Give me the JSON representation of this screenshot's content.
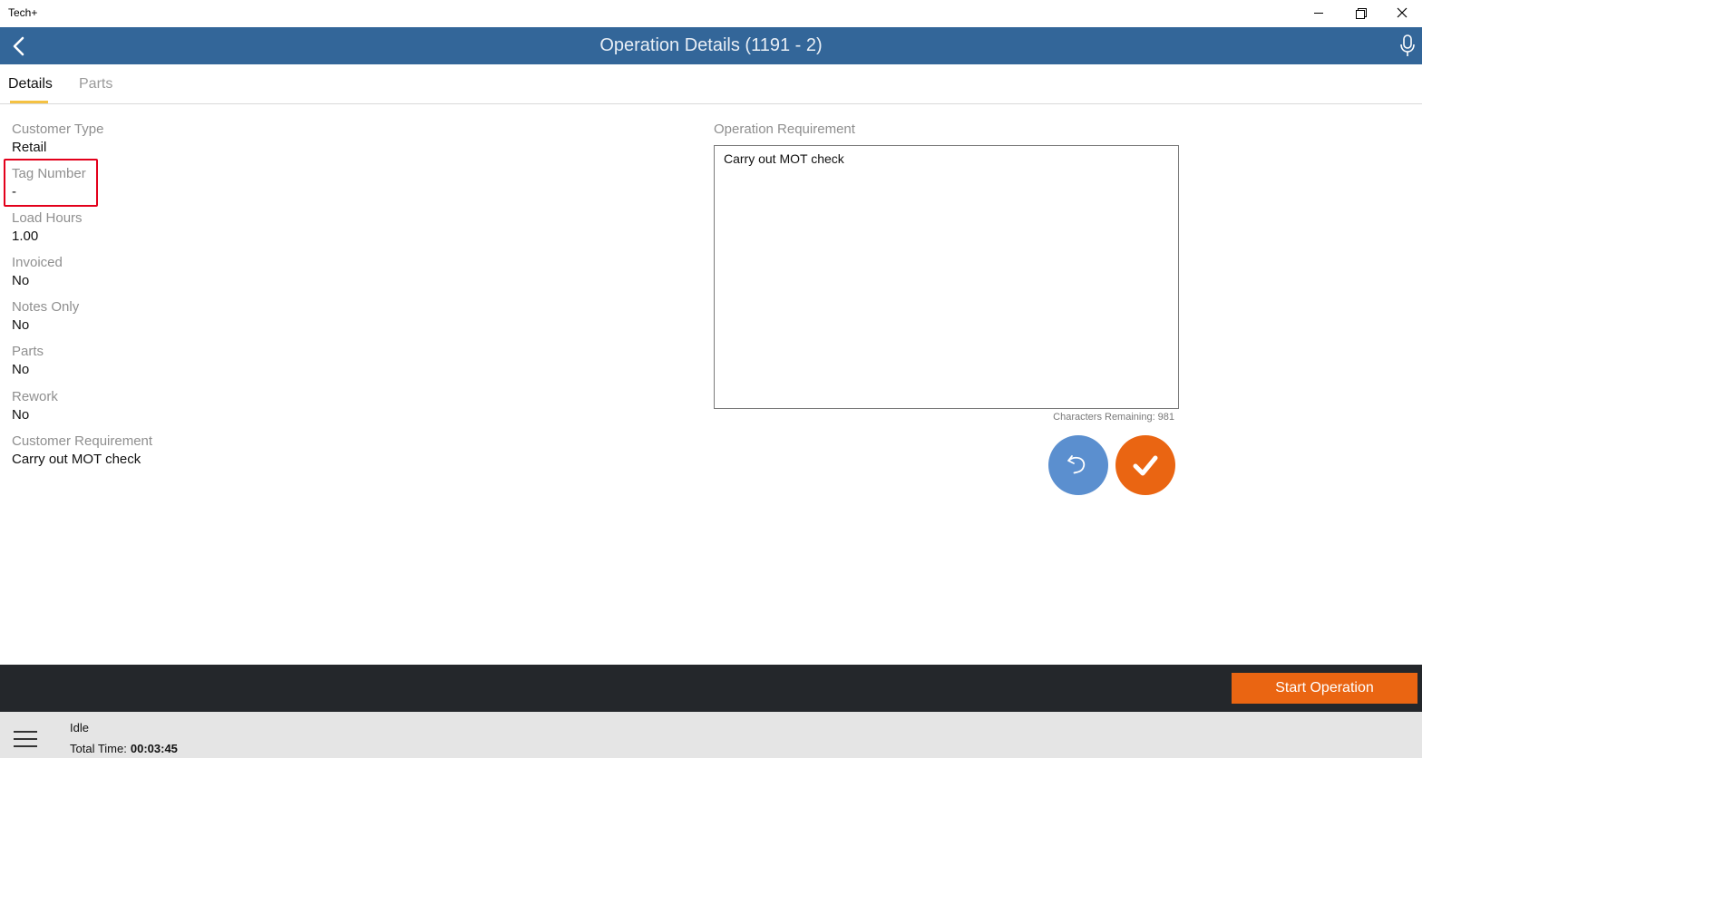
{
  "window": {
    "app_title": "Tech+"
  },
  "header": {
    "title": "Operation Details (1191 - 2)",
    "back_icon": "chevron-left-icon",
    "mic_icon": "microphone-icon"
  },
  "tabs": [
    {
      "label": "Details",
      "active": true
    },
    {
      "label": "Parts",
      "active": false
    }
  ],
  "fields": [
    {
      "label": "Customer Type",
      "value": "Retail"
    },
    {
      "label": "Tag Number",
      "value": "-"
    },
    {
      "label": "Load Hours",
      "value": "1.00"
    },
    {
      "label": "Invoiced",
      "value": "No"
    },
    {
      "label": "Notes Only",
      "value": "No"
    },
    {
      "label": "Parts",
      "value": "No"
    },
    {
      "label": "Rework",
      "value": "No"
    },
    {
      "label": "Customer Requirement",
      "value": "Carry out MOT check"
    }
  ],
  "operation": {
    "label": "Operation Requirement",
    "value": "Carry out MOT check",
    "chars_remaining_label": "Characters Remaining:",
    "chars_remaining_value": "981"
  },
  "actions": {
    "start_label": "Start Operation"
  },
  "status": {
    "state": "Idle",
    "total_time_label": "Total Time:",
    "total_time_value": "00:03:45"
  },
  "colors": {
    "header": "#336699",
    "accent_orange": "#ea6512",
    "undo_blue": "#5b8fcf",
    "tab_underline": "#f5c242",
    "highlight": "#e3001b"
  }
}
